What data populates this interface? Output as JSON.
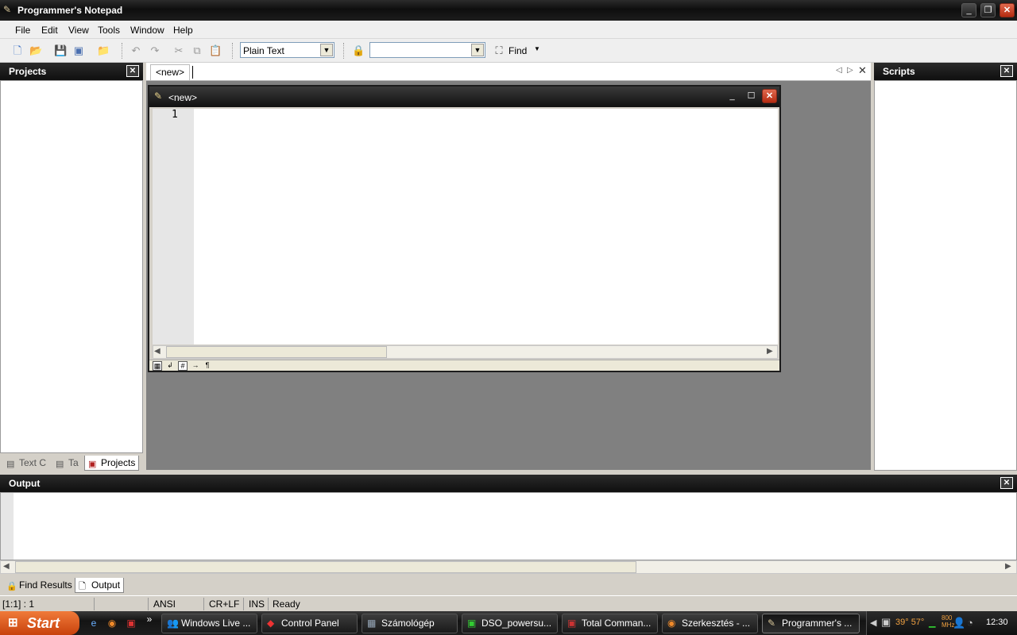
{
  "window": {
    "title": "Programmer's Notepad"
  },
  "menu": [
    "File",
    "Edit",
    "View",
    "Tools",
    "Window",
    "Help"
  ],
  "toolbar": {
    "scheme_value": "Plain Text",
    "find_combo_value": "",
    "find_label": "Find"
  },
  "projects_panel": {
    "title": "Projects",
    "tabs": [
      "Text C",
      "Ta",
      "Projects"
    ]
  },
  "scripts_panel": {
    "title": "Scripts"
  },
  "document": {
    "tab_label": "<new>",
    "window_title": "<new>",
    "line_number": "1"
  },
  "output_panel": {
    "title": "Output",
    "tabs": [
      "Find Results",
      "Output"
    ]
  },
  "statusbar": {
    "position": "[1:1] : 1",
    "encoding": "ANSI",
    "line_endings": "CR+LF",
    "insert_mode": "INS",
    "status": "Ready"
  },
  "taskbar": {
    "start_label": "Start",
    "items": [
      "Windows Live ...",
      "Control Panel",
      "Számológép",
      "DSO_powersu...",
      "Total Comman...",
      "Szerkesztés - ...",
      "Programmer's ..."
    ],
    "tray_temp": "39° 57°",
    "tray_mhz": "800 MHz",
    "clock": "12:30"
  }
}
